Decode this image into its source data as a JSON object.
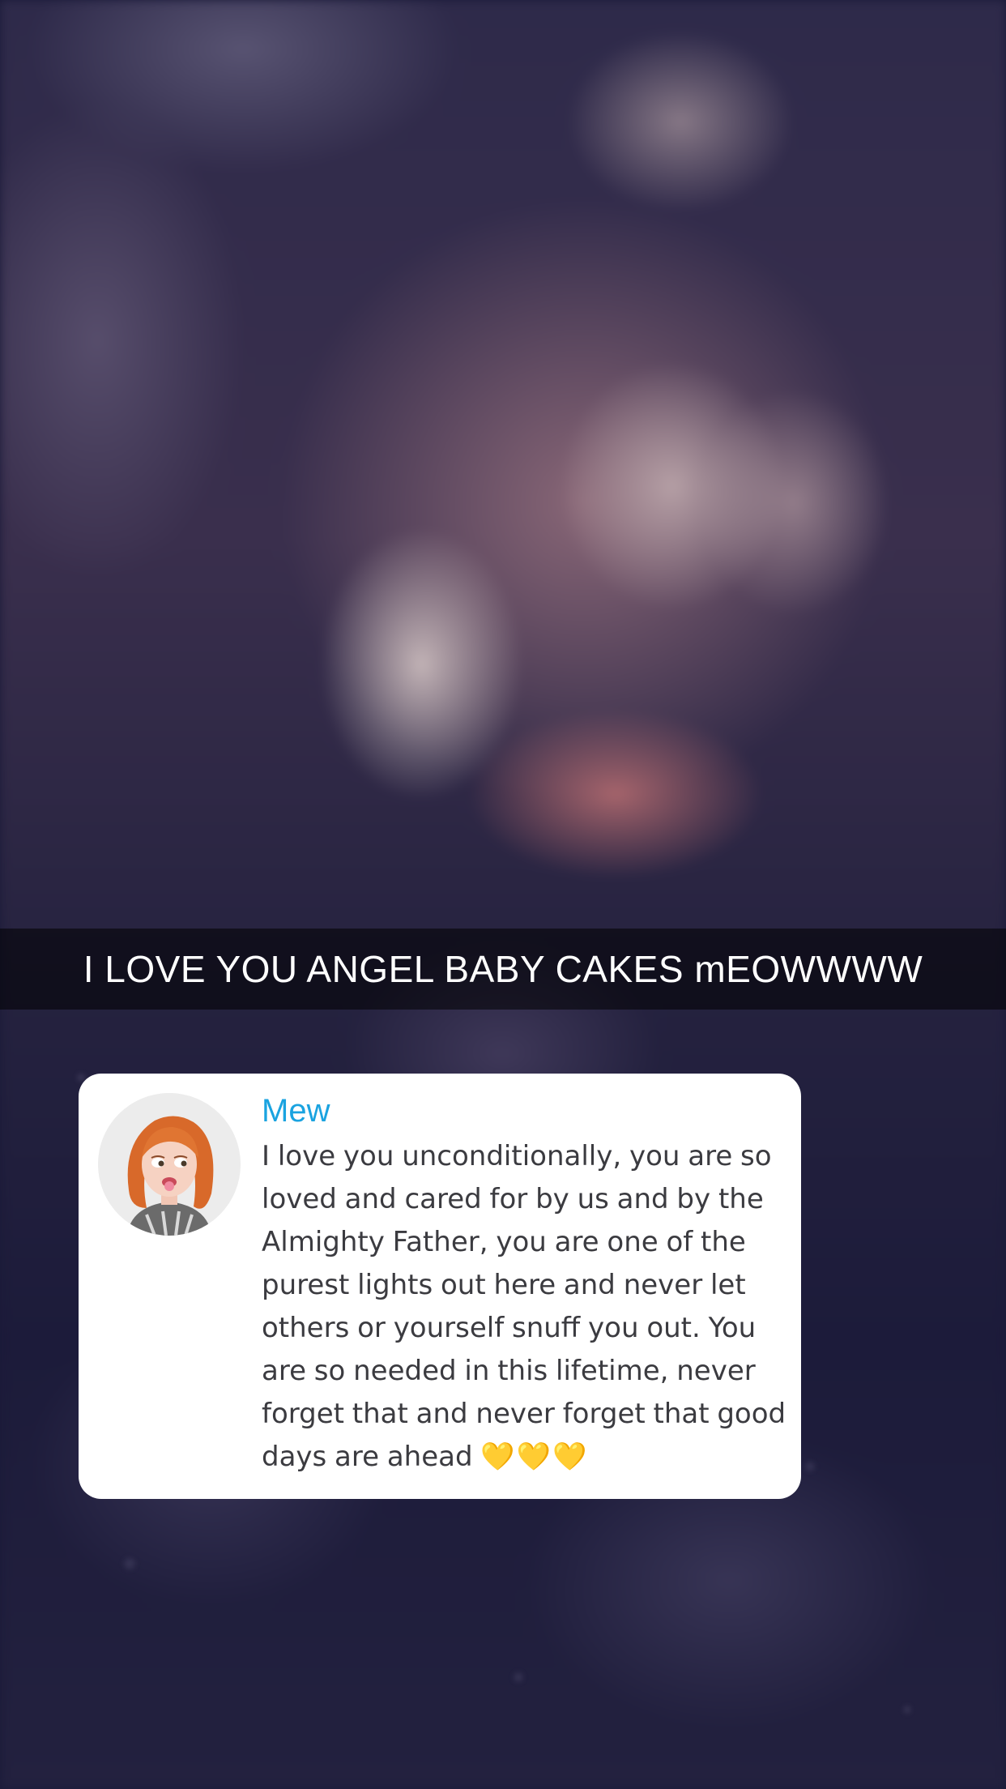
{
  "caption": {
    "text": "I LOVE YOU ANGEL BABY CAKES mEOWWWW"
  },
  "reply_card": {
    "avatar_icon": "bitmoji-avatar-icon",
    "sender_name": "Mew",
    "message": "I love you unconditionally, you are so loved and cared for by us and by the Almighty Father, you are one of the purest lights out here and never let others or yourself snuff you out. You are so needed in this lifetime, never forget that and never forget that good days are ahead",
    "hearts": "💛💛💛"
  },
  "colors": {
    "sender_name": "#1aa3e0",
    "message_text": "#3b3b40",
    "hearts": "#f2c21b",
    "caption_bar": "rgba(0,0,0,0.55)"
  }
}
